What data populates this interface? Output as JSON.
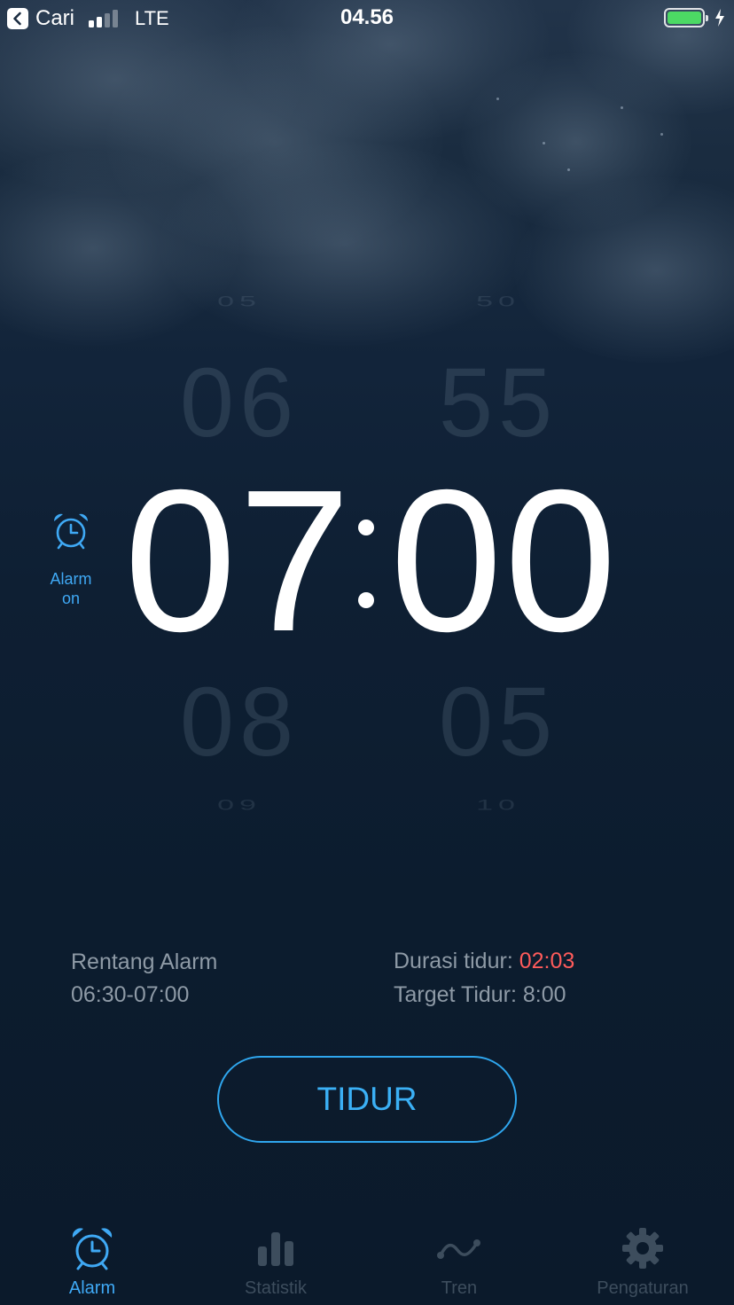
{
  "status_bar": {
    "back_label": "Cari",
    "network": "LTE",
    "time": "04.56",
    "battery_color": "#4cd964"
  },
  "picker": {
    "hours": {
      "far_above": "05",
      "above": "06",
      "selected": "07",
      "below": "08",
      "far_below": "09"
    },
    "minutes": {
      "far_above": "50",
      "above": "55",
      "selected": "00",
      "below": "05",
      "far_below": "10"
    }
  },
  "alarm_toggle": {
    "label": "Alarm\non",
    "icon": "alarm-clock-icon",
    "state": "on"
  },
  "info": {
    "range_title": "Rentang Alarm",
    "range_value": "06:30-07:00",
    "duration_label": "Durasi tidur: ",
    "duration_value": "02:03",
    "target_label": "Target Tidur: ",
    "target_value": "8:00"
  },
  "sleep_button": {
    "label": "TIDUR"
  },
  "tabs": [
    {
      "label": "Alarm",
      "icon": "alarm-clock-icon",
      "active": true
    },
    {
      "label": "Statistik",
      "icon": "bar-chart-icon",
      "active": false
    },
    {
      "label": "Tren",
      "icon": "trend-line-icon",
      "active": false
    },
    {
      "label": "Pengaturan",
      "icon": "gear-icon",
      "active": false
    }
  ],
  "colors": {
    "accent": "#3fa9f5",
    "warning": "#ff5b5b",
    "inactive_tab": "#3d4d5d",
    "muted_text": "#8e9aa6"
  }
}
